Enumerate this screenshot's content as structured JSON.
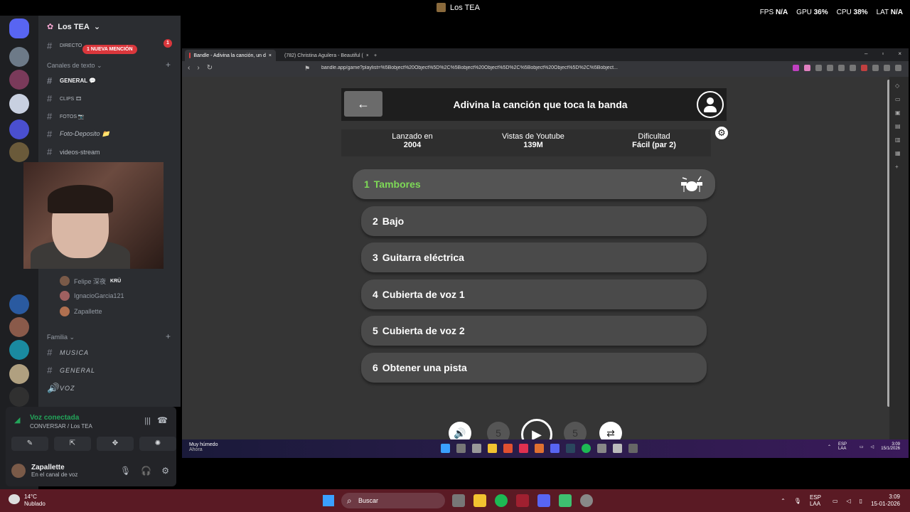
{
  "overlay": {
    "window_title": "Los TEA",
    "stats": [
      {
        "label": "FPS",
        "value": "N/A"
      },
      {
        "label": "GPU",
        "value": "36%"
      },
      {
        "label": "CPU",
        "value": "38%"
      },
      {
        "label": "LAT",
        "value": "N/A"
      }
    ]
  },
  "discord": {
    "server_name": "Los TEA",
    "direct_label": "DIRECTO",
    "mention_badge": "1 NUEVA MENCIÓN",
    "mention_count": "1",
    "text_category": "Canales de texto",
    "channels": [
      {
        "name": "GENERAL 💬"
      },
      {
        "name": "CLIPS 🎞"
      },
      {
        "name": "FOTOS 📷"
      },
      {
        "name": "Foto-Deposito 📁"
      },
      {
        "name": "videos-stream"
      }
    ],
    "voice_users": [
      {
        "name": "Felipe 深夜",
        "tag": "KRÜ"
      },
      {
        "name": "IgnacioGarcia121"
      },
      {
        "name": "Zapallette"
      }
    ],
    "family_category": "Familia",
    "family_channels": [
      {
        "name": "MUSICA"
      },
      {
        "name": "GENERAL"
      },
      {
        "name": "VOZ"
      }
    ],
    "voice_panel": {
      "status": "Voz conectada",
      "location": "CONVERSAR / Los TEA",
      "username": "Zapallette",
      "user_status": "En el canal de voz"
    }
  },
  "browser": {
    "tabs": [
      {
        "title": "Bandle - Adivina la canción, un d",
        "favicon_color": "#e04040"
      },
      {
        "title": "(782) Christina Aguilera - Beautiful (",
        "favicon_color": "#ff0000"
      }
    ],
    "url": "bandle.app/game?playlist=%5Bobject%20Object%5D%2C%5Bobject%20Object%5D%2C%5Bobject%20Object%5D%2C%5Bobject..."
  },
  "game": {
    "title": "Adivina la canción que toca la banda",
    "info": [
      {
        "label": "Lanzado en",
        "value": "2004"
      },
      {
        "label": "Vistas de Youtube",
        "value": "139M"
      },
      {
        "label": "Dificultad",
        "value": "Fácil (par 2)"
      }
    ],
    "tracks": [
      {
        "num": "1",
        "name": "Tambores"
      },
      {
        "num": "2",
        "name": "Bajo"
      },
      {
        "num": "3",
        "name": "Guitarra eléctrica"
      },
      {
        "num": "4",
        "name": "Cubierta de voz 1"
      },
      {
        "num": "5",
        "name": "Cubierta de voz 2"
      },
      {
        "num": "6",
        "name": "Obtener una pista"
      }
    ],
    "rewind_label": "5",
    "forward_label": "5",
    "accent_color": "#7ed957"
  },
  "inner_taskbar": {
    "weather": "Muy húmedo",
    "weather_sub": "Ahora",
    "lang": "ESP LAA",
    "time": "3:09",
    "date": "15/1/2026"
  },
  "taskbar": {
    "temp": "14°C",
    "weather": "Nublado",
    "search_label": "Buscar",
    "lang": "ESP LAA",
    "time": "3:09",
    "date": "15-01-2026"
  }
}
